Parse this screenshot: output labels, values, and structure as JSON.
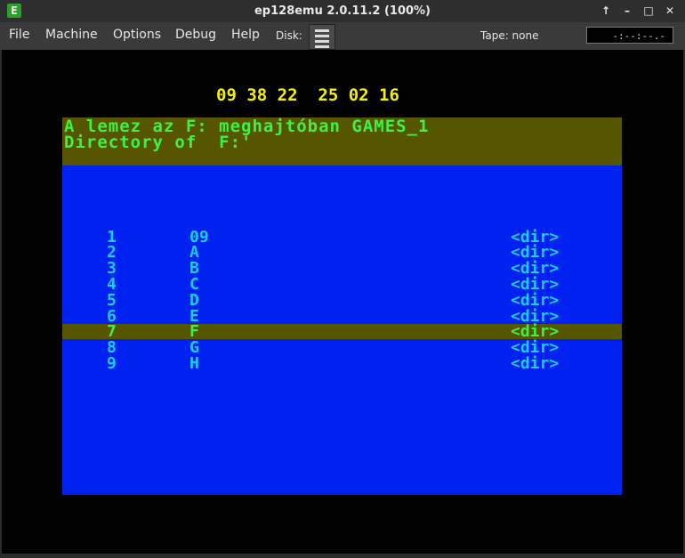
{
  "window": {
    "title": "ep128emu 2.0.11.2 (100%)",
    "icon_letter": "E"
  },
  "window_buttons": {
    "up": "↑",
    "minimize": "–",
    "maximize": "□",
    "close": "✕"
  },
  "menu": {
    "file": "File",
    "machine": "Machine",
    "options": "Options",
    "debug": "Debug",
    "help": "Help"
  },
  "status": {
    "disk_label": "Disk:",
    "tape_label": "Tape: none",
    "tape_position": "-:--:--.-"
  },
  "screen": {
    "clock": "09 38 22  25 02 16",
    "header_line1": "A lemez az F: meghajtóban GAMES_1",
    "header_line2": "Directory of  F:'",
    "entries": [
      {
        "num": "1",
        "name": "09",
        "type": "<dir>"
      },
      {
        "num": "2",
        "name": "A",
        "type": "<dir>"
      },
      {
        "num": "3",
        "name": "B",
        "type": "<dir>"
      },
      {
        "num": "4",
        "name": "C",
        "type": "<dir>"
      },
      {
        "num": "5",
        "name": "D",
        "type": "<dir>"
      },
      {
        "num": "6",
        "name": "E",
        "type": "<dir>"
      },
      {
        "num": "7",
        "name": "F",
        "type": "<dir>"
      },
      {
        "num": "8",
        "name": "G",
        "type": "<dir>"
      },
      {
        "num": "9",
        "name": "H",
        "type": "<dir>"
      }
    ]
  },
  "colors": {
    "header_bg": "#565600",
    "list_bg": "#0022f0",
    "list_text": "#1ccbf0",
    "highlight_text": "#3ff23f",
    "clock_text": "#f2f200"
  }
}
